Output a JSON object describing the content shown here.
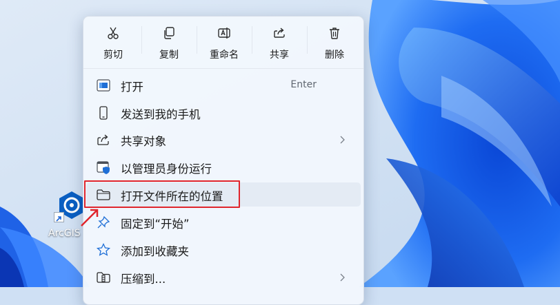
{
  "desktop": {
    "icon_label": "ArcGIS"
  },
  "context_menu": {
    "actions": [
      {
        "label": "剪切",
        "icon": "scissors-icon"
      },
      {
        "label": "复制",
        "icon": "copy-icon"
      },
      {
        "label": "重命名",
        "icon": "rename-icon"
      },
      {
        "label": "共享",
        "icon": "share-icon"
      },
      {
        "label": "删除",
        "icon": "trash-icon"
      }
    ],
    "items": [
      {
        "label": "打开",
        "shortcut": "Enter",
        "icon": "open-window-icon"
      },
      {
        "label": "发送到我的手机",
        "icon": "phone-icon"
      },
      {
        "label": "共享对象",
        "icon": "share-arrow-icon",
        "submenu": true
      },
      {
        "label": "以管理员身份运行",
        "icon": "admin-shield-icon"
      },
      {
        "label": "打开文件所在的位置",
        "icon": "folder-icon",
        "highlighted": true
      },
      {
        "label": "固定到“开始”",
        "icon": "pin-icon"
      },
      {
        "label": "添加到收藏夹",
        "icon": "star-icon"
      },
      {
        "label": "压缩到...",
        "icon": "compress-folder-icon",
        "submenu": true
      }
    ]
  },
  "colors": {
    "accent": "#0067c0",
    "annotation_red": "#e0242b",
    "menu_bg": "#f2f7fd"
  }
}
